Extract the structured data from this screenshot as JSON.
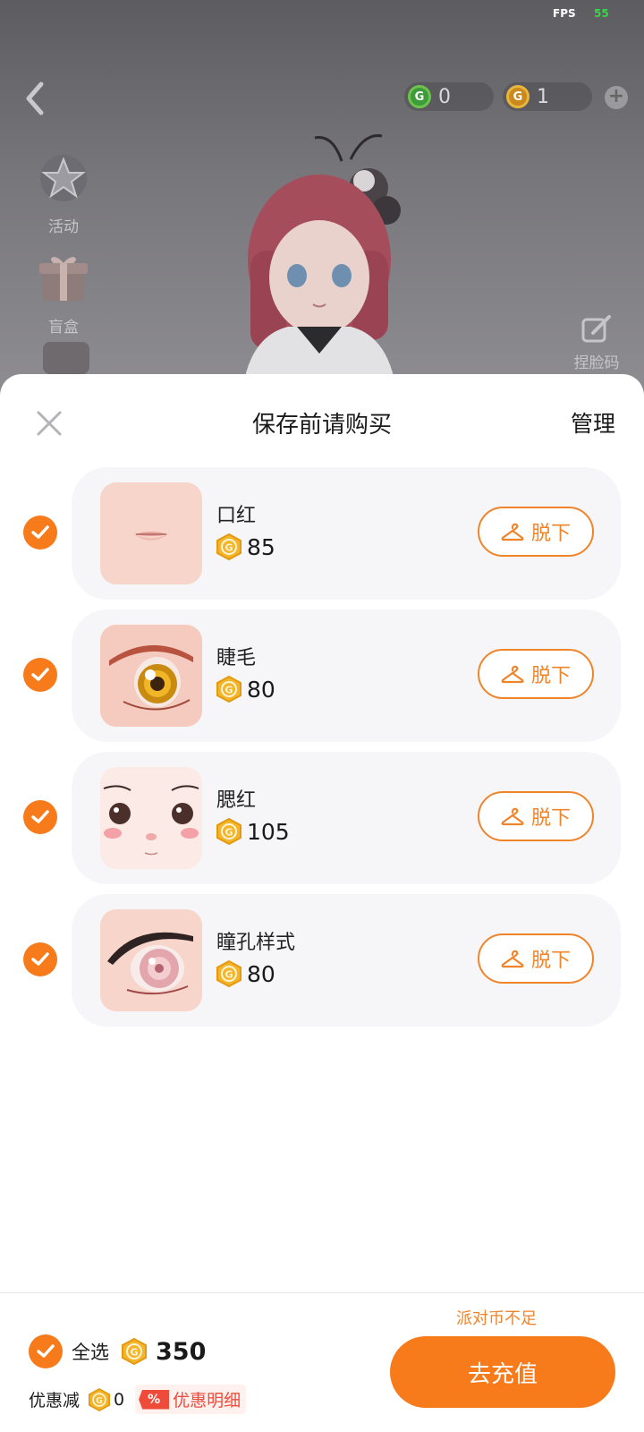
{
  "status": {
    "fps_label": "FPS",
    "fps_value": "55"
  },
  "header": {
    "wallet": [
      {
        "icon": "party-coin-icon",
        "value": "0"
      },
      {
        "icon": "gold-coin-icon",
        "value": "1"
      }
    ],
    "add_icon": "plus-icon"
  },
  "side_menu": [
    {
      "icon": "star-icon",
      "label": "活动"
    },
    {
      "icon": "gift-box-icon",
      "label": "盲盒"
    }
  ],
  "face_code": {
    "icon": "edit-icon",
    "label": "捏脸码"
  },
  "sheet": {
    "title": "保存前请购买",
    "manage_label": "管理",
    "items": [
      {
        "name": "口红",
        "price": "85",
        "button_label": "脱下",
        "checked": true,
        "thumb": "lips"
      },
      {
        "name": "睫毛",
        "price": "80",
        "button_label": "脱下",
        "checked": true,
        "thumb": "eye-gold"
      },
      {
        "name": "腮红",
        "price": "105",
        "button_label": "脱下",
        "checked": true,
        "thumb": "face"
      },
      {
        "name": "瞳孔样式",
        "price": "80",
        "button_label": "脱下",
        "checked": true,
        "thumb": "eye-pink"
      }
    ]
  },
  "footer": {
    "insufficient_text": "派对币不足",
    "select_all_label": "全选",
    "total": "350",
    "discount_label": "优惠减",
    "discount_value": "0",
    "discount_badge": "%",
    "detail_label": "优惠明细",
    "recharge_label": "去充值"
  },
  "colors": {
    "accent": "#f77a1b",
    "sheet_bg": "#ffffff",
    "card_bg": "#f6f6f8",
    "discount_red": "#ef4b3b"
  }
}
